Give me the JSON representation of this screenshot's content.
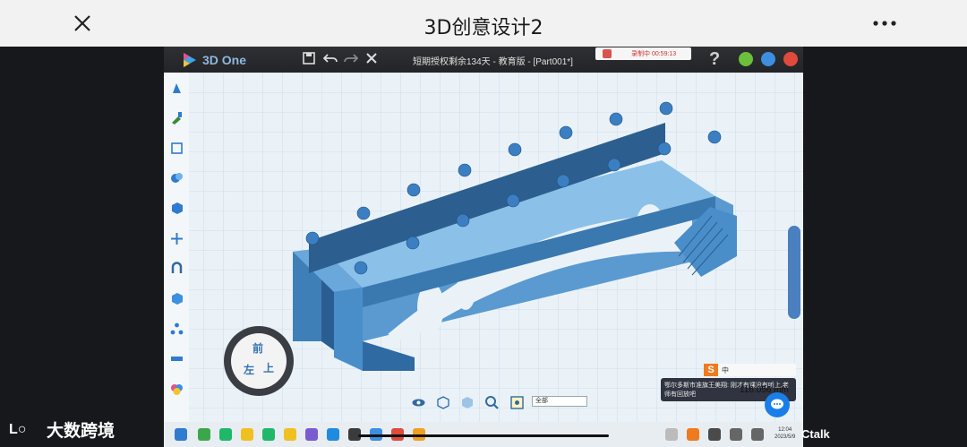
{
  "header": {
    "title": "3D创意设计2",
    "close_icon": "close-icon",
    "more_icon": "more-horizontal-icon"
  },
  "app": {
    "name": "3D One",
    "doc_title": "短期授权剩余134天 - 教育版 - [Part001*]",
    "recording": "录制中 00:59:13",
    "help": "?",
    "toolbar_icons": [
      "save-icon",
      "undo-icon",
      "redo-icon",
      "delete-icon"
    ]
  },
  "viewport": {
    "view_cube_faces": {
      "top": "前",
      "left": "左",
      "right": "上"
    },
    "view_select": "全部",
    "zoom_readout": "116.056 mm",
    "chat_message": "鄂尔多斯市准旗王美翔: 刚才有课没有听上,老师有回放吧",
    "ime_label": "S",
    "ime_text": "中"
  },
  "taskbar": {
    "time": "12:04",
    "date": "2023/5/9"
  },
  "footer": {
    "brand_left": "大数跨境",
    "brand_right": "Ctalk"
  },
  "colors": {
    "model_blue": "#4a8ec9",
    "grid_bg": "#eaf2f8",
    "accent": "#1a7ee8"
  }
}
